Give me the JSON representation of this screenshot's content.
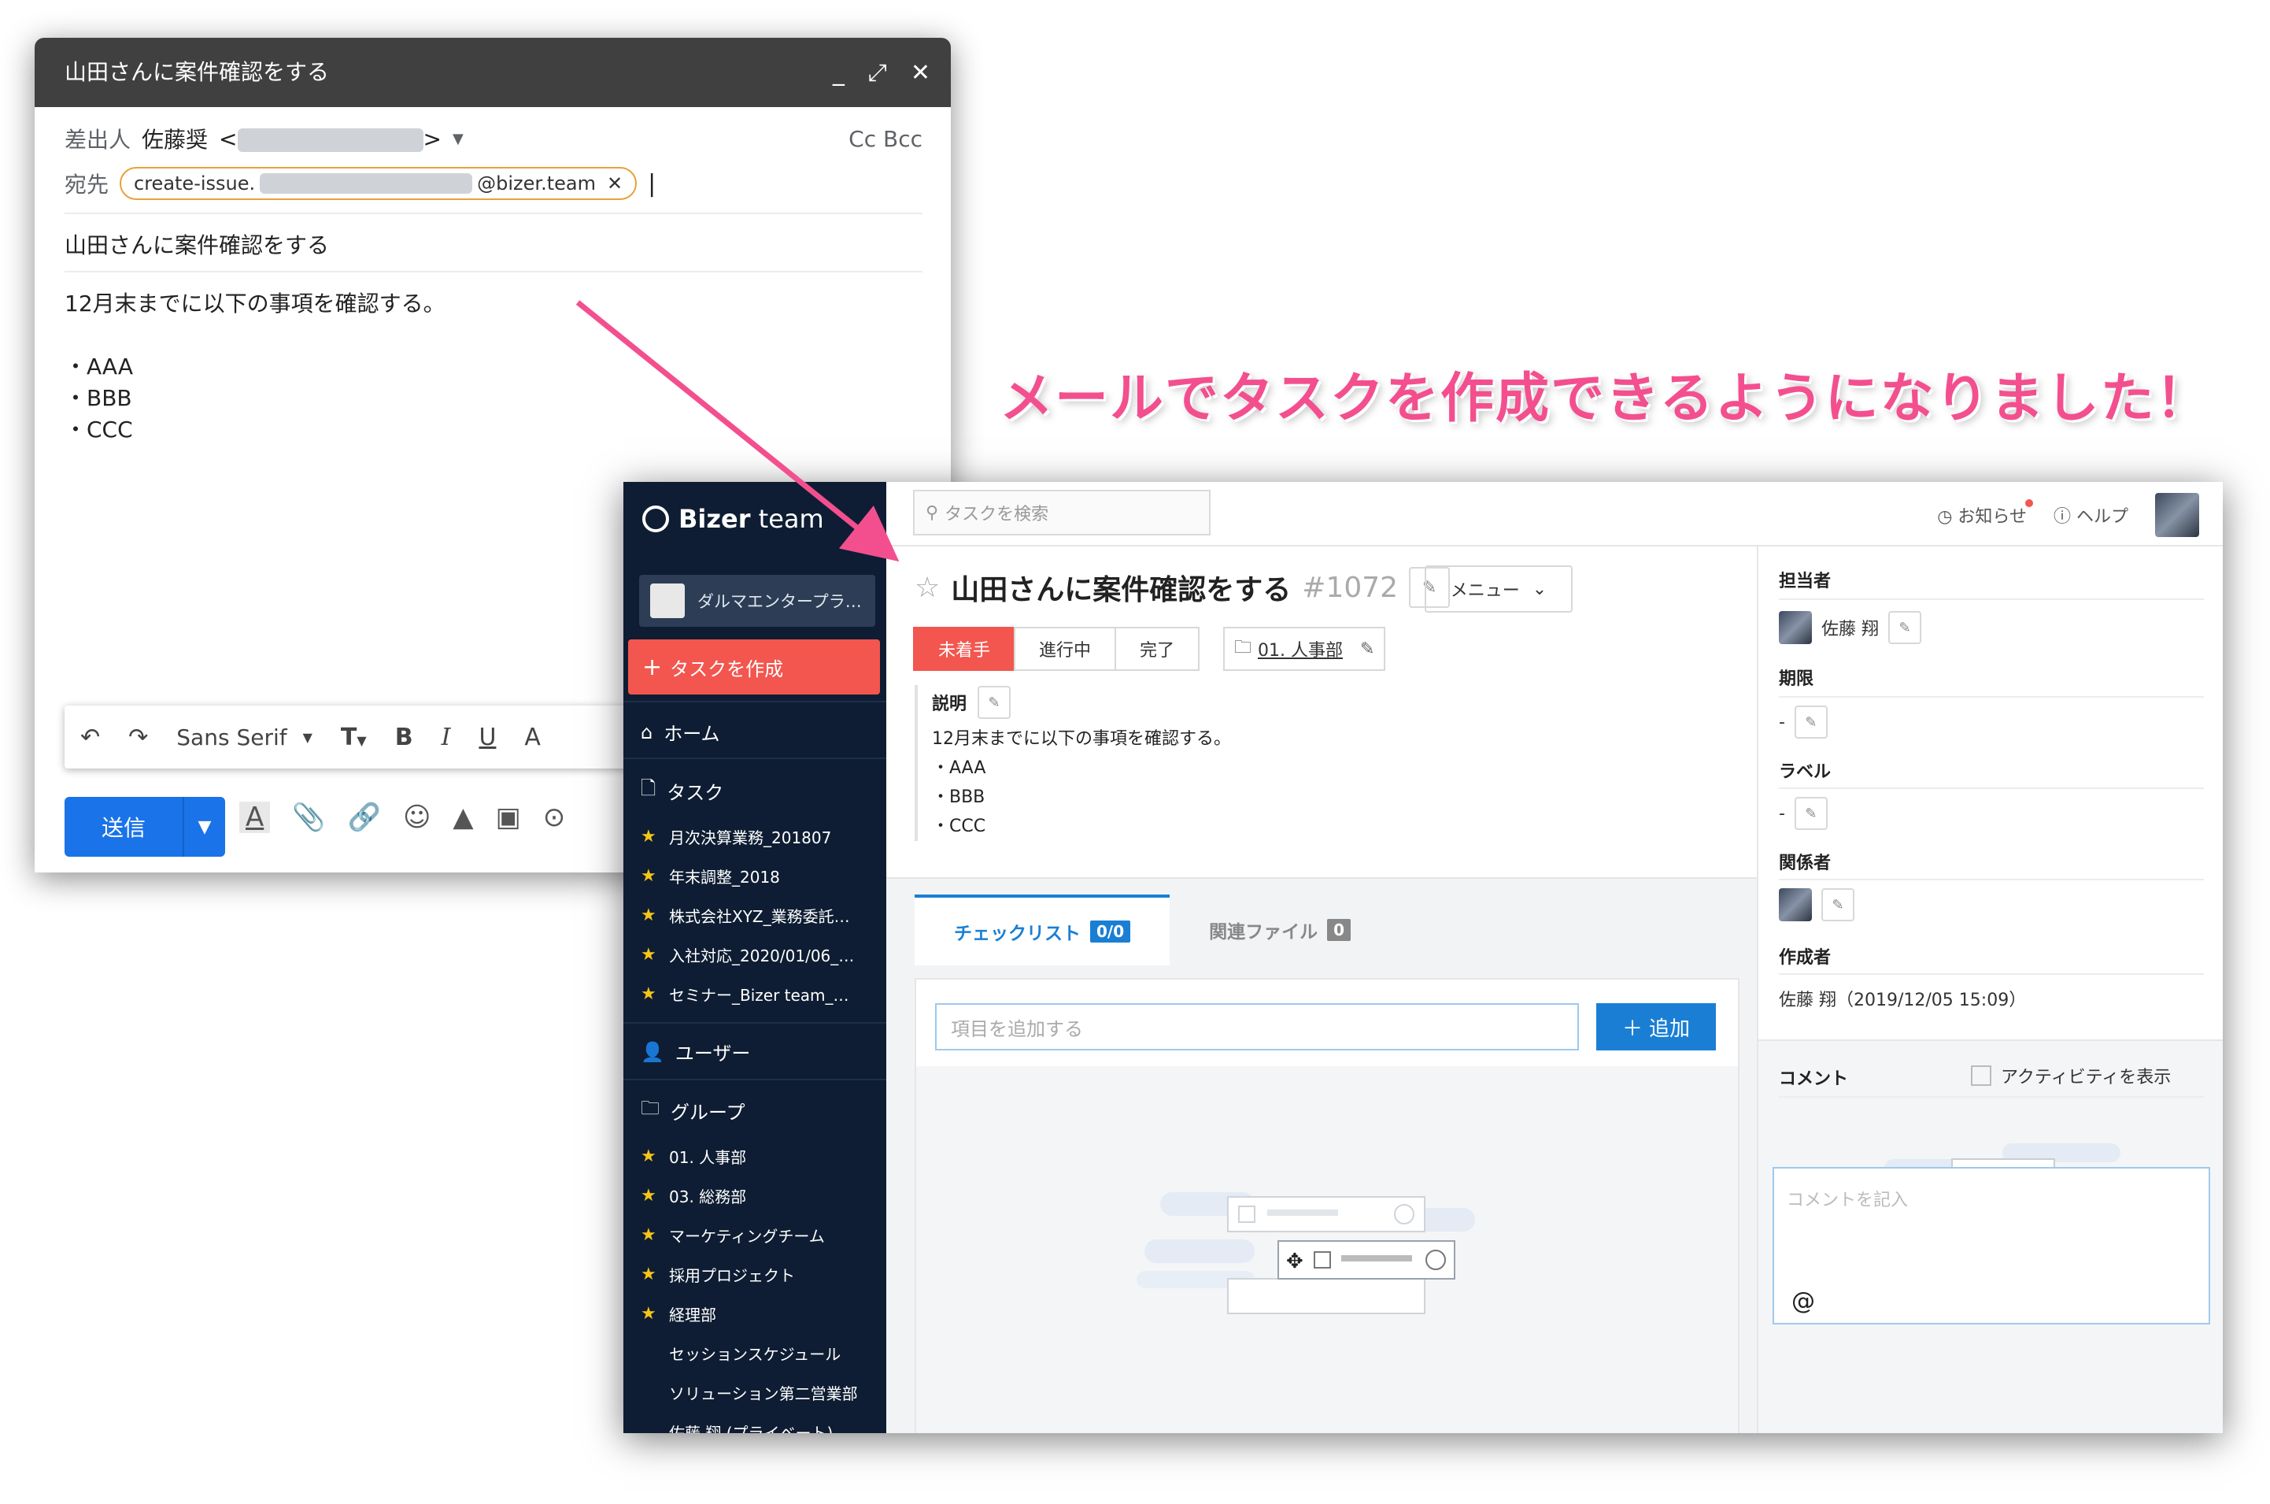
{
  "compose": {
    "title": "山田さんに案件確認をする",
    "from_label": "差出人",
    "from_name": "佐藤奨",
    "cc_bcc": "Cc Bcc",
    "to_label": "宛先",
    "to_chip_prefix": "create-issue.",
    "to_chip_suffix": "@bizer.team",
    "subject": "山田さんに案件確認をする",
    "body_lines": [
      "12月末までに以下の事項を確認する。",
      "",
      "・AAA",
      "・BBB",
      "・CCC"
    ],
    "font_select": "Sans Serif",
    "send_label": "送信"
  },
  "headline": "メールでタスクを作成できるようになりました！",
  "bizer": {
    "logo_bold": "Bizer",
    "logo_light": " team",
    "org_name": "ダルマエンタープラ…",
    "create_task": "タスクを作成",
    "nav_home": "ホーム",
    "nav_tasks": "タスク",
    "task_items": [
      "月次決算業務_201807",
      "年末調整_2018",
      "株式会社XYZ_業務委託…",
      "入社対応_2020/01/06_…",
      "セミナー_Bizer team_…"
    ],
    "nav_users": "ユーザー",
    "nav_groups": "グループ",
    "group_items_starred": [
      "01. 人事部",
      "03. 総務部",
      "マーケティングチーム",
      "採用プロジェクト",
      "経理部"
    ],
    "group_items_plain": [
      "セッションスケジュール",
      "ソリューション第二営業部",
      "佐藤 翔 (プライベート)"
    ],
    "search_placeholder": "タスクを検索",
    "notifications": "お知らせ",
    "help": "ヘルプ",
    "task_title": "山田さんに案件確認をする",
    "task_number": "#1072",
    "menu_label": "メニュー",
    "status_options": [
      "未着手",
      "進行中",
      "完了"
    ],
    "group_tag": "01. 人事部",
    "description_label": "説明",
    "description_lines": [
      "12月末までに以下の事項を確認する。",
      "・AAA",
      "・BBB",
      "・CCC"
    ],
    "tab_checklist": "チェックリスト",
    "tab_checklist_count": "0/0",
    "tab_files": "関連ファイル",
    "tab_files_count": "0",
    "add_item_placeholder": "項目を追加する",
    "add_button": "追加",
    "assignee_label": "担当者",
    "assignee_name": "佐藤 翔",
    "deadline_label": "期限",
    "deadline_value": "-",
    "labels_label": "ラベル",
    "labels_value": "-",
    "related_label": "関係者",
    "creator_label": "作成者",
    "creator_value": "佐藤 翔（2019/12/05 15:09）",
    "comment_label": "コメント",
    "activity_label": "アクティビティを表示",
    "comment_placeholder": "コメントを記入",
    "at_sign": "@"
  },
  "colors": {
    "accent_blue": "#1a7fd4",
    "status_red": "#f2564e",
    "headline_pink": "#f34f8e",
    "sidebar_bg": "#0e1d33",
    "gmail_send": "#1a73e8"
  }
}
